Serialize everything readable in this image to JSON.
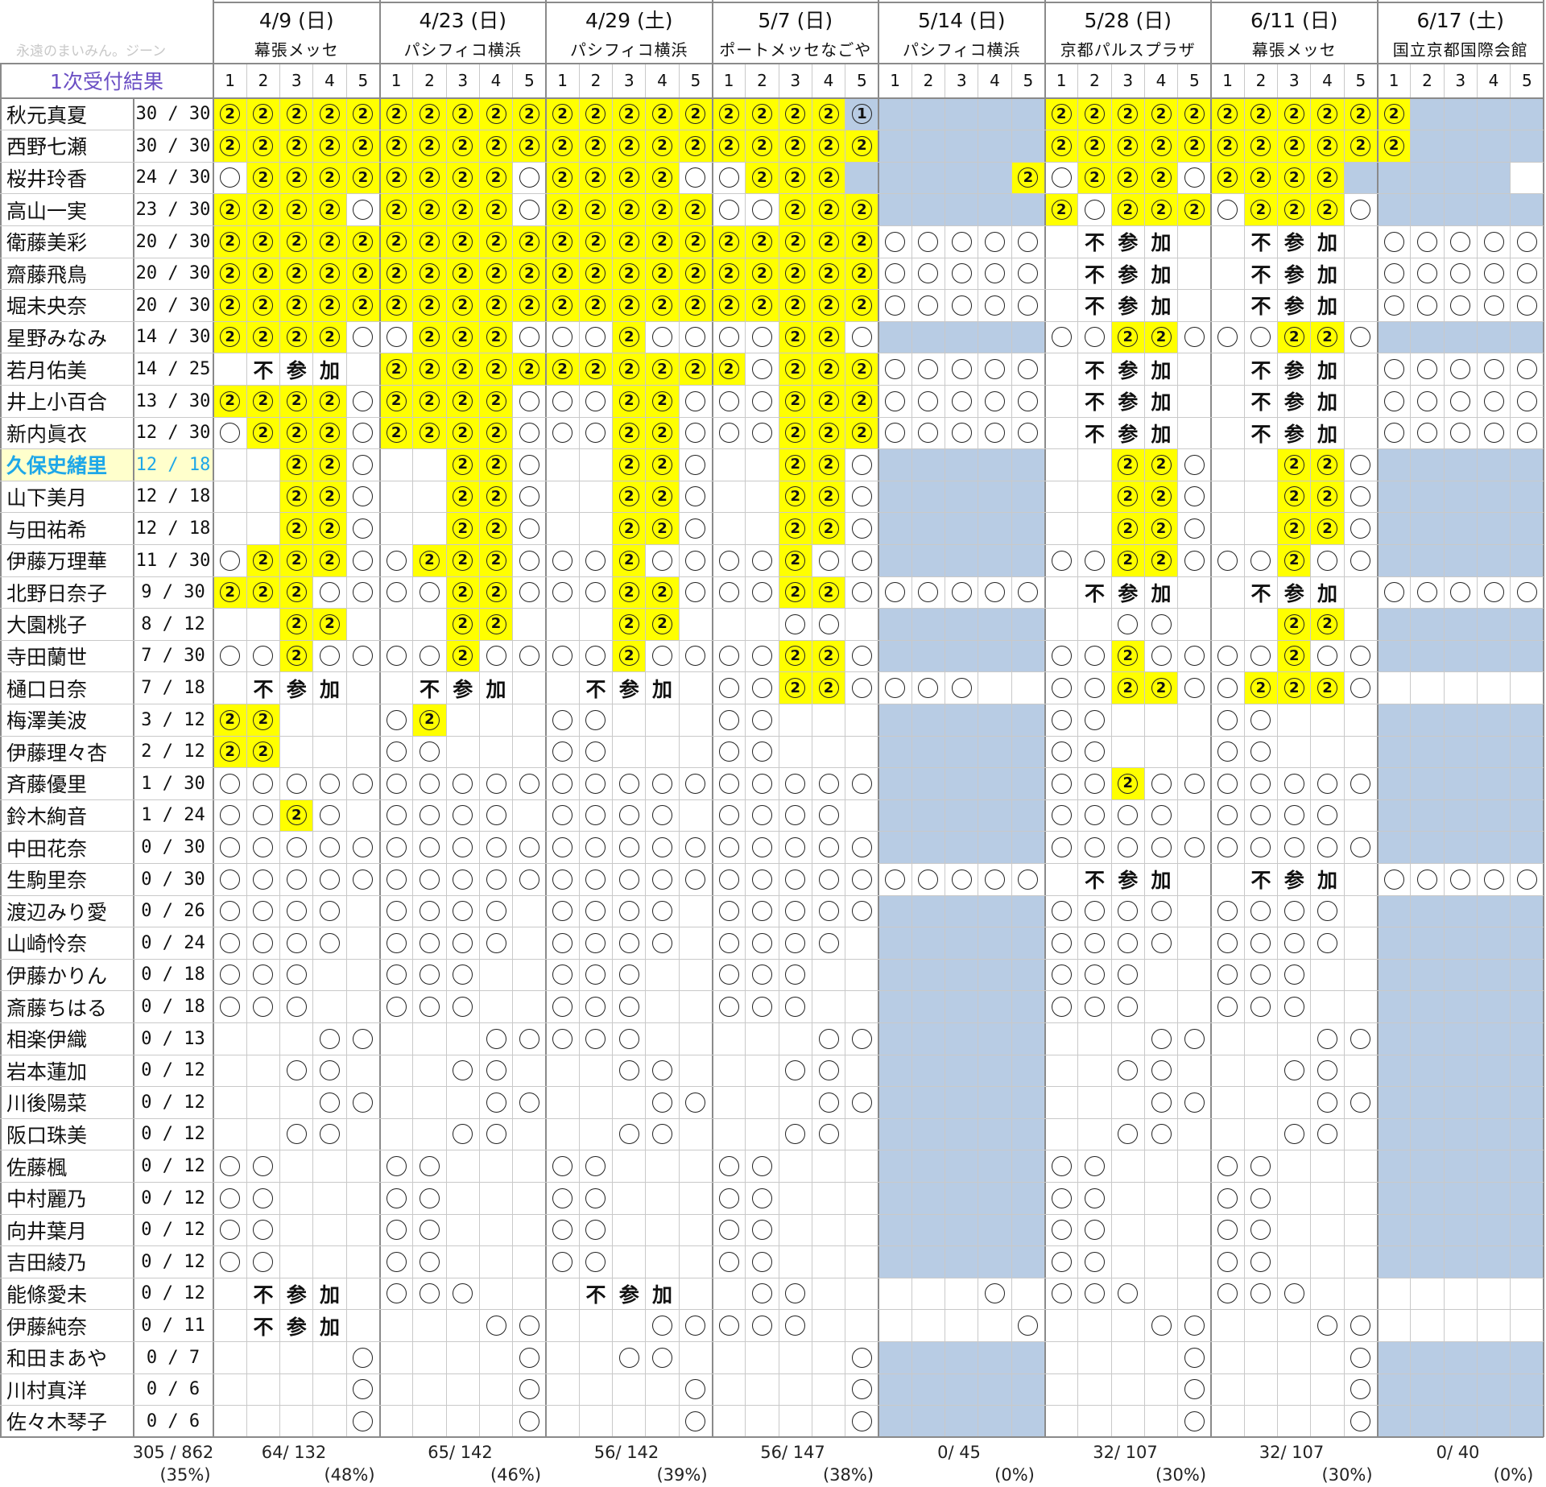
{
  "header": {
    "watermark": "永遠のまいみん。ジーン",
    "title": "1次受付結果",
    "events": [
      {
        "date": "4/9 (日)",
        "venue": "幕張メッセ"
      },
      {
        "date": "4/23 (日)",
        "venue": "パシフィコ横浜"
      },
      {
        "date": "4/29 (土)",
        "venue": "パシフィコ横浜"
      },
      {
        "date": "5/7 (日)",
        "venue": "ポートメッセなごや"
      },
      {
        "date": "5/14 (日)",
        "venue": "パシフィコ横浜"
      },
      {
        "date": "5/28 (日)",
        "venue": "京都パルスプラザ"
      },
      {
        "date": "6/11 (日)",
        "venue": "幕張メッセ"
      },
      {
        "date": "6/17 (土)",
        "venue": "国立京都国際会館"
      }
    ],
    "slot_labels": [
      "1",
      "2",
      "3",
      "4",
      "5"
    ]
  },
  "legend": {
    "two": "②",
    "one": "①",
    "fusanka": [
      "不",
      "参",
      "加"
    ]
  },
  "members": [
    {
      "name": "秋元真夏",
      "count": "30 / 30",
      "cells": "22222222222222222221BBBBB22222222222BBBBB"
    },
    {
      "name": "西野七瀬",
      "count": "30 / 30",
      "cells": "22222222222222222222BBBBB22222222222BBBBB"
    },
    {
      "name": "桜井玲香",
      "count": "24 / 30",
      "cells": "o22222222o2222oo222BBBBB2o222o2222BBBBB"
    },
    {
      "name": "高山一実",
      "count": "23 / 30",
      "cells": "2222o2222o22222oo222BBBBB2o222o222oBBBBB"
    },
    {
      "name": "衛藤美彩",
      "count": "20 / 30",
      "cells": "22222222222222222222oooooxFSKxxFSKxooooo"
    },
    {
      "name": "齋藤飛鳥",
      "count": "20 / 30",
      "cells": "22222222222222222222oooooxFSKxxFSKxooooo"
    },
    {
      "name": "堀未央奈",
      "count": "20 / 30",
      "cells": "22222222222222222222oooooxFSKxxFSKxooooo"
    },
    {
      "name": "星野みなみ",
      "count": "14 / 30",
      "cells": "2222oo222ooo2oooo22oBBBBBoo22ooo22oBBBBB"
    },
    {
      "name": "若月佑美",
      "count": "14 / 25",
      "cells": "xFSKx22222222222o222oooooxFSKxxFSKxooooo"
    },
    {
      "name": "井上小百合",
      "count": "13 / 30",
      "cells": "2222o2222ooo22ooo222oooooxFSKxxFSKxooooo"
    },
    {
      "name": "新内眞衣",
      "count": "12 / 30",
      "cells": "o222o2222ooo22ooo222oooooxFSKxxFSKxooooo"
    },
    {
      "name": "久保史緒里",
      "count": "12 / 18",
      "cells": "xx22oxx22oxx22oxx22oBBBBBxx22oxx22oBBBBB",
      "hl": true
    },
    {
      "name": "山下美月",
      "count": "12 / 18",
      "cells": "xx22oxx22oxx22oxx22oBBBBBxx22oxx22oBBBBB"
    },
    {
      "name": "与田祐希",
      "count": "12 / 18",
      "cells": "xx22oxx22oxx22oxx22oBBBBBxx22oxx22oBBBBB"
    },
    {
      "name": "伊藤万理華",
      "count": "11 / 30",
      "cells": "o222oo222ooo2oooo2ooBBBBBoo22ooo2ooBBBBB"
    },
    {
      "name": "北野日奈子",
      "count": "9 / 30",
      "cells": "222oooo22ooo22ooo22ooooooxFSKxxFSKxooooo"
    },
    {
      "name": "大園桃子",
      "count": "8 / 12",
      "cells": "xx22xxx22xxx22xxxooxBBBBBxxooxxx22xBBBBB"
    },
    {
      "name": "寺田蘭世",
      "count": "7 / 30",
      "cells": "oo2oooo2oooo2oooo22oBBBBBoo2oooo2ooBBBBB"
    },
    {
      "name": "樋口日奈",
      "count": "7 / 18",
      "cells": "xFSKxxFSKxxFSKxoo22ooooxxoo22oo222oxxxxx"
    },
    {
      "name": "梅澤美波",
      "count": "3 / 12",
      "cells": "22xxxo2xxxooxxxooxxxBBBBBooxxxooxxxBBBBB"
    },
    {
      "name": "伊藤理々杏",
      "count": "2 / 12",
      "cells": "22xxxooxxxooxxxooxxxBBBBBooxxxooxxxBBBBB"
    },
    {
      "name": "斉藤優里",
      "count": "1 / 30",
      "cells": "ooooooooooooooooooooBBBBBoo2oooooooBBBBB"
    },
    {
      "name": "鈴木絢音",
      "count": "1 / 24",
      "cells": "oo2oxooooxooooxooooxBBBBBooooxooooxBBBBB"
    },
    {
      "name": "中田花奈",
      "count": "0 / 30",
      "cells": "ooooooooooooooooooooBBBBBooooooooooBBBBB"
    },
    {
      "name": "生駒里奈",
      "count": "0 / 30",
      "cells": "oooooooooooooooooooooooooxFSKxxFSKxooooo"
    },
    {
      "name": "渡辺みり愛",
      "count": "0 / 26",
      "cells": "ooooxooooxooooxoooooBBBBBooooxooooxBBBBB"
    },
    {
      "name": "山崎怜奈",
      "count": "0 / 24",
      "cells": "ooooxooooxooooxooooxBBBBBooooxooooxBBBBB"
    },
    {
      "name": "伊藤かりん",
      "count": "0 / 18",
      "cells": "oooxxoooxxoooxxoooxxBBBBBoooxxoooxxBBBBB"
    },
    {
      "name": "斎藤ちはる",
      "count": "0 / 18",
      "cells": "oooxxoooxxoooxxoooxxBBBBBoooxxoooxxBBBBB"
    },
    {
      "name": "相楽伊織",
      "count": "0 / 13",
      "cells": "xxxooxxxoooooxxxxxooBBBBBxxxooxxxooBBBBB"
    },
    {
      "name": "岩本蓮加",
      "count": "0 / 12",
      "cells": "xxooxxxooxxxooxxxooxBBBBBxxooxxxooxBBBBB"
    },
    {
      "name": "川後陽菜",
      "count": "0 / 12",
      "cells": "xxxooxxxooxxxooxxxooBBBBBxxxooxxxooBBBBB"
    },
    {
      "name": "阪口珠美",
      "count": "0 / 12",
      "cells": "xxooxxxooxxxooxxxooxBBBBBxxooxxxooxBBBBB"
    },
    {
      "name": "佐藤楓",
      "count": "0 / 12",
      "cells": "ooxxxooxxxooxxxooxxxBBBBBooxxxooxxxBBBBB"
    },
    {
      "name": "中村麗乃",
      "count": "0 / 12",
      "cells": "ooxxxooxxxooxxxooxxxBBBBBooxxxooxxxBBBBB"
    },
    {
      "name": "向井葉月",
      "count": "0 / 12",
      "cells": "ooxxxooxxxooxxxooxxxBBBBBooxxxooxxxBBBBB"
    },
    {
      "name": "吉田綾乃",
      "count": "0 / 12",
      "cells": "ooxxxooxxxooxxxooxxxBBBBBooxxxooxxxBBBBB"
    },
    {
      "name": "能條愛未",
      "count": "0 / 12",
      "cells": "xFSKxoooxxxFSKxxooxxxxxoxoooxxoooxxxxxxx"
    },
    {
      "name": "伊藤純奈",
      "count": "0 / 11",
      "cells": "xFSKxxxxooxxxoooooxxxxxxoxxxooxxxooxxxxx"
    },
    {
      "name": "和田まあや",
      "count": "0 / 7",
      "cells": "xxxxoxxxxoxxooxxxxxoBBBBBxxxxoxxxxoBBBBB"
    },
    {
      "name": "川村真洋",
      "count": "0 / 6",
      "cells": "xxxxoxxxxoxxxxoxxxxoBBBBBxxxxoxxxxoBBBBB"
    },
    {
      "name": "佐々木琴子",
      "count": "0 / 6",
      "cells": "xxxxoxxxxoxxxxoxxxxoBBBBBxxxxoxxxxoBBBBB"
    }
  ],
  "totals": {
    "overall": "305 / 862",
    "overall_pct": "(35%)",
    "events": [
      {
        "value": "64/ 132",
        "pct": "(48%)"
      },
      {
        "value": "65/ 142",
        "pct": "(46%)"
      },
      {
        "value": "56/ 142",
        "pct": "(39%)"
      },
      {
        "value": "56/ 147",
        "pct": "(38%)"
      },
      {
        "value": "0/ 45",
        "pct": "(0%)"
      },
      {
        "value": "32/ 107",
        "pct": "(30%)"
      },
      {
        "value": "32/ 107",
        "pct": "(30%)"
      },
      {
        "value": "0/ 40",
        "pct": "(0%)"
      }
    ]
  },
  "colors": {
    "win2": "#ffff00",
    "blue": "#b8cce4",
    "highlight": "#1ea7e8",
    "title": "#6b4fc4"
  }
}
